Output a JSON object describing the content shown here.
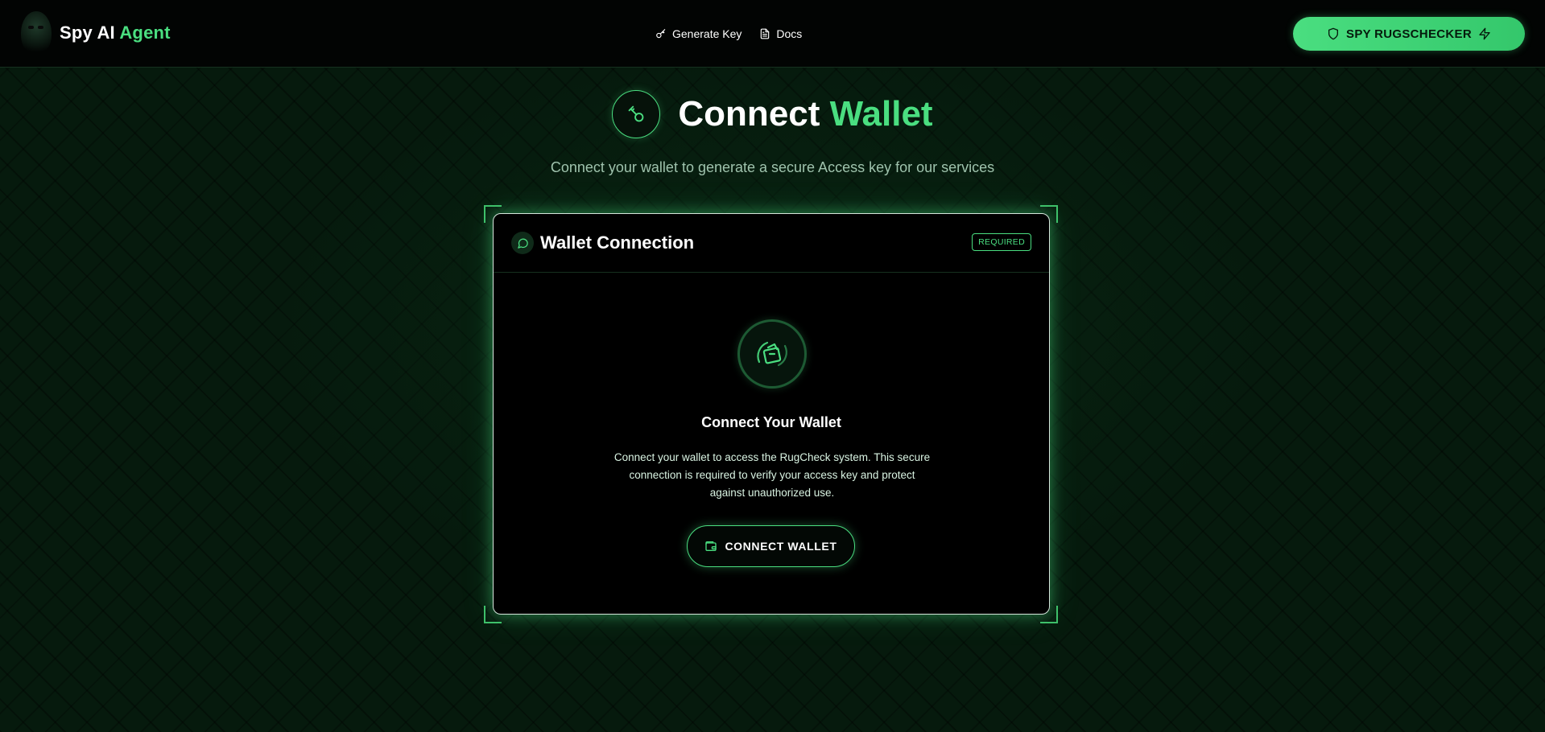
{
  "header": {
    "brand_main": "Spy AI",
    "brand_accent": "Agent",
    "nav": [
      {
        "label": "Generate Key",
        "icon": "key-icon"
      },
      {
        "label": "Docs",
        "icon": "document-icon"
      }
    ],
    "cta": {
      "label": "SPY RUGSCHECKER",
      "icon_left": "shield-icon",
      "icon_right": "lightning-icon"
    }
  },
  "hero": {
    "title_main": "Connect",
    "title_accent": "Wallet",
    "icon": "key-icon",
    "subtitle": "Connect your wallet to generate a secure Access key for our services"
  },
  "card": {
    "title": "Wallet Connection",
    "title_icon": "chat-icon",
    "badge": "REQUIRED",
    "center_icon": "wallet-icon",
    "heading": "Connect Your Wallet",
    "description": "Connect your wallet to access the RugCheck system. This secure connection is required to verify your access key and protect against unauthorized use.",
    "button": {
      "label": "CONNECT WALLET",
      "icon": "wallet-icon"
    }
  },
  "colors": {
    "accent": "#4ade80",
    "background": "#061a0d",
    "card": "#000000"
  }
}
